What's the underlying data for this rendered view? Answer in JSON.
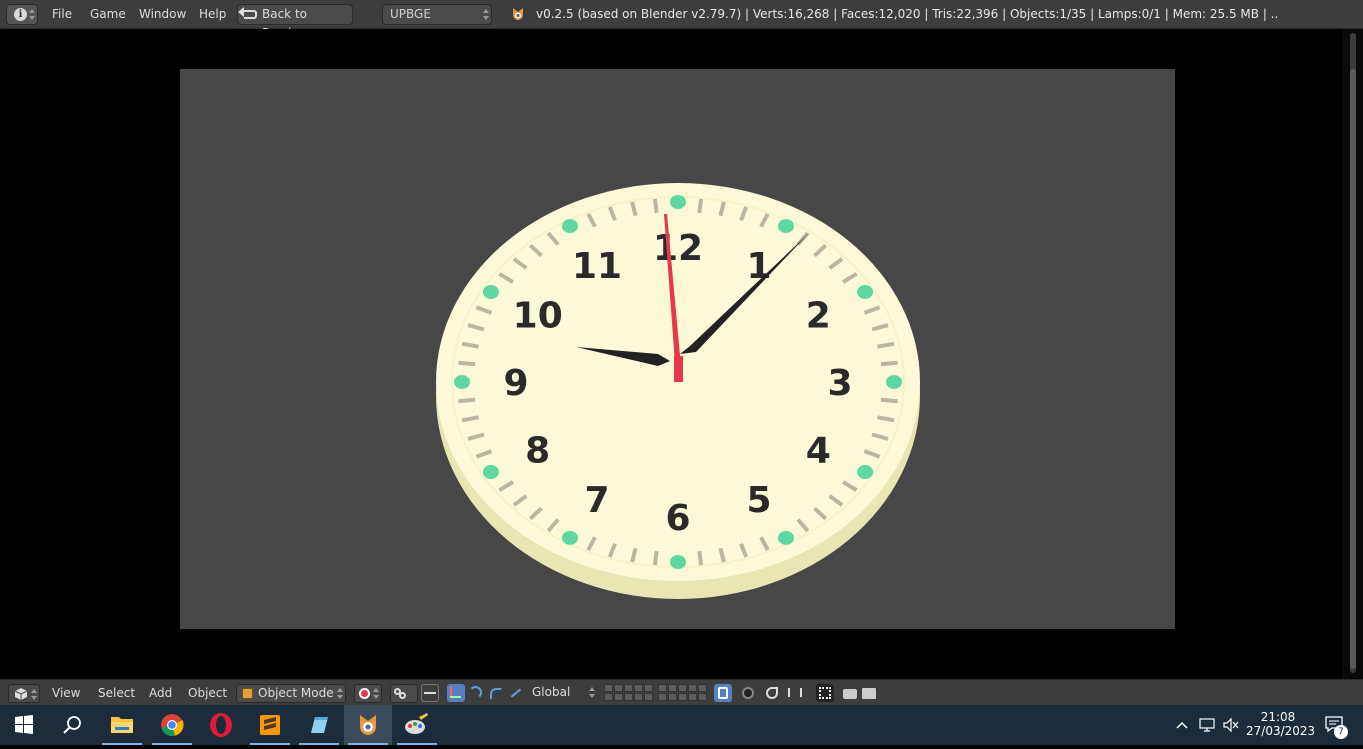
{
  "topbar": {
    "menu": [
      "File",
      "Game",
      "Window",
      "Help"
    ],
    "back_button": "Back to Previous",
    "engine": "UPBGE",
    "stats": "v0.2.5 (based on Blender v2.79.7)  | Verts:16,268 | Faces:12,020 | Tris:22,396 | Objects:1/35 | Lamps:0/1 | Mem: 25.5 MB | .."
  },
  "viewport": {
    "clock": {
      "numbers": [
        "12",
        "1",
        "2",
        "3",
        "4",
        "5",
        "6",
        "7",
        "8",
        "9",
        "10",
        "11"
      ],
      "time_shown": {
        "hour": 9,
        "minute": 8,
        "second": 59
      },
      "colors": {
        "face": "#fbf9d8",
        "rim": "#e8e6b4",
        "numerals": "#2a2a2a",
        "dots": "#5fd8a0",
        "ticks": "#b9b7a0",
        "second_hand": "#e8364a",
        "hands": "#222222"
      }
    },
    "background": "#474747"
  },
  "bottombar": {
    "menu": [
      "View",
      "Select",
      "Add",
      "Object"
    ],
    "mode": "Object Mode",
    "orientation": "Global"
  },
  "taskbar": {
    "apps": [
      "start-icon",
      "search-icon",
      "file-explorer-icon",
      "chrome-icon",
      "opera-icon",
      "sublime-text-icon",
      "notepad-icon",
      "upbge-icon",
      "paint-icon"
    ],
    "time": "21:08",
    "date": "27/03/2023",
    "notification_count": "7"
  }
}
